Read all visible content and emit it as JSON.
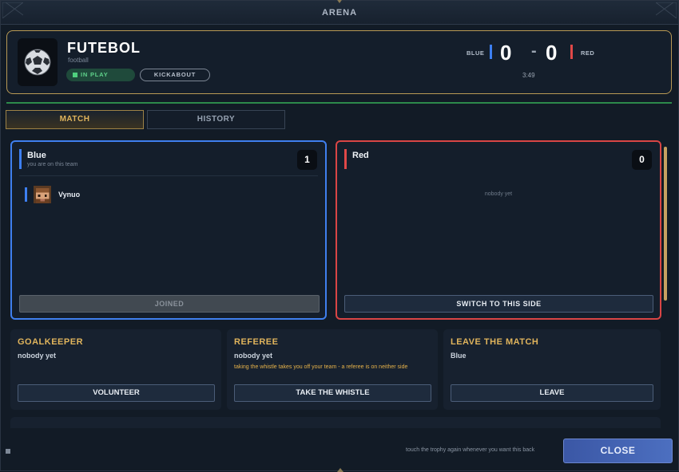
{
  "window": {
    "title": "ARENA"
  },
  "game": {
    "title": "FUTEBOL",
    "subtitle": "football",
    "status": "IN PLAY",
    "mode": "KICKABOUT",
    "icon": "soccer-ball-icon"
  },
  "score": {
    "blue_label": "BLUE",
    "blue_score": "0",
    "separator": "-",
    "red_score": "0",
    "red_label": "RED",
    "clock": "3:49"
  },
  "tabs": [
    {
      "label": "MATCH",
      "active": true
    },
    {
      "label": "HISTORY",
      "active": false
    }
  ],
  "teams": {
    "blue": {
      "name": "Blue",
      "note": "you are on this team",
      "count": "1",
      "players": [
        {
          "name": "Vynuo"
        }
      ],
      "button": "JOINED",
      "color": "#3f7fee"
    },
    "red": {
      "name": "Red",
      "count": "0",
      "empty_text": "nobody yet",
      "button": "SWITCH TO THIS SIDE",
      "color": "#d94545"
    }
  },
  "cards": {
    "goalkeeper": {
      "heading": "GOALKEEPER",
      "value": "nobody yet",
      "button": "VOLUNTEER"
    },
    "referee": {
      "heading": "REFEREE",
      "value": "nobody yet",
      "warning": "taking the whistle takes you off your team - a referee is on neither side",
      "button": "TAKE THE WHISTLE"
    },
    "leave": {
      "heading": "LEAVE THE MATCH",
      "value": "Blue",
      "button": "LEAVE"
    }
  },
  "footer": {
    "hint": "touch the trophy again whenever you want this back",
    "close": "CLOSE"
  },
  "colors": {
    "accent_gold": "#e0b45c",
    "in_play_green": "#5fd38b",
    "close_blue": "#4c6fc0"
  }
}
